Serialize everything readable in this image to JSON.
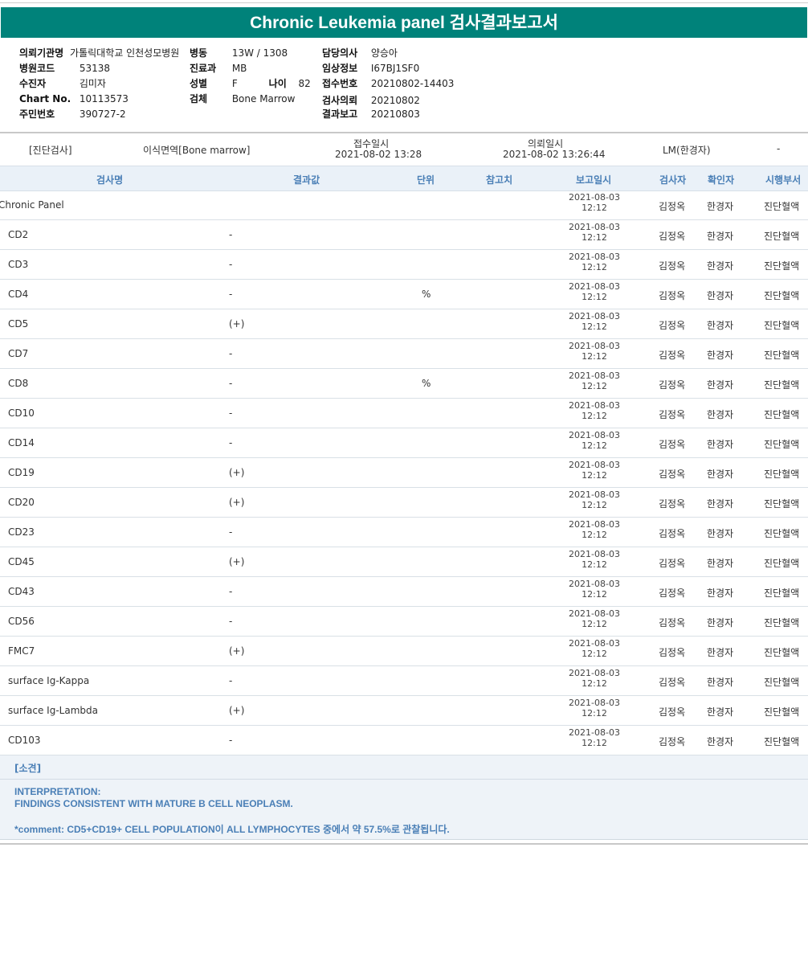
{
  "report": {
    "title": "Chronic Leukemia panel 검사결과보고서"
  },
  "patient": {
    "hospital_label": "의뢰기관명",
    "hospital_value": "가톨릭대학교 인천성모병원",
    "code_label": "병원코드",
    "code_value": "53138",
    "patient_label": "수진자",
    "patient_value": "김미자",
    "chart_label": "Chart No.",
    "chart_value": "10113573",
    "resident_label": "주민번호",
    "resident_value": "390727-2",
    "ward_label": "병동",
    "ward_value": "13W / 1308",
    "dept_label": "진료과",
    "dept_value": "MB",
    "sex_label": "성별",
    "sex_value": "F",
    "age_label": "나이",
    "age_value": "82",
    "specimen_label": "검체",
    "specimen_value": "Bone Marrow",
    "doctor_label": "담당의사",
    "doctor_value": "양승아",
    "clinical_label": "임상정보",
    "clinical_value": "I67BJ1SF0",
    "receipt_label": "접수번호",
    "receipt_value": "20210802-14403",
    "request_label": "검사의뢰",
    "request_value": "20210802",
    "result_label": "결과보고",
    "result_value": "20210803"
  },
  "summary": {
    "category": "[진단검사]",
    "test_type": "이식면역[Bone marrow]",
    "receipt_time_label": "접수일시",
    "receipt_time_value": "2021-08-02 13:28",
    "request_time_label": "의뢰일시",
    "request_time_value": "2021-08-02 13:26:44",
    "requester": "LM(한경자)",
    "dash": "-"
  },
  "table": {
    "headers": [
      "검사명",
      "결과값",
      "단위",
      "참고치",
      "보고일시",
      "검사자",
      "확인자",
      "시행부서"
    ],
    "rows": [
      {
        "name": "Chronic Panel",
        "result": "",
        "unit": "",
        "date": "2021-08-03",
        "time": "12:12",
        "checker": "김정옥",
        "confirmer": "한경자",
        "dept": "진단혈액"
      },
      {
        "name": "CD2",
        "result": "-",
        "unit": "",
        "date": "2021-08-03",
        "time": "12:12",
        "checker": "김정옥",
        "confirmer": "한경자",
        "dept": "진단혈액"
      },
      {
        "name": "CD3",
        "result": "-",
        "unit": "",
        "date": "2021-08-03",
        "time": "12:12",
        "checker": "김정옥",
        "confirmer": "한경자",
        "dept": "진단혈액"
      },
      {
        "name": "CD4",
        "result": "-",
        "unit": "%",
        "date": "2021-08-03",
        "time": "12:12",
        "checker": "김정옥",
        "confirmer": "한경자",
        "dept": "진단혈액"
      },
      {
        "name": "CD5",
        "result": "(+)",
        "unit": "",
        "date": "2021-08-03",
        "time": "12:12",
        "checker": "김정옥",
        "confirmer": "한경자",
        "dept": "진단혈액"
      },
      {
        "name": "CD7",
        "result": "-",
        "unit": "",
        "date": "2021-08-03",
        "time": "12:12",
        "checker": "김정옥",
        "confirmer": "한경자",
        "dept": "진단혈액"
      },
      {
        "name": "CD8",
        "result": "-",
        "unit": "%",
        "date": "2021-08-03",
        "time": "12:12",
        "checker": "김정옥",
        "confirmer": "한경자",
        "dept": "진단혈액"
      },
      {
        "name": "CD10",
        "result": "-",
        "unit": "",
        "date": "2021-08-03",
        "time": "12:12",
        "checker": "김정옥",
        "confirmer": "한경자",
        "dept": "진단혈액"
      },
      {
        "name": "CD14",
        "result": "-",
        "unit": "",
        "date": "2021-08-03",
        "time": "12:12",
        "checker": "김정옥",
        "confirmer": "한경자",
        "dept": "진단혈액"
      },
      {
        "name": "CD19",
        "result": "(+)",
        "unit": "",
        "date": "2021-08-03",
        "time": "12:12",
        "checker": "김정옥",
        "confirmer": "한경자",
        "dept": "진단혈액"
      },
      {
        "name": "CD20",
        "result": "(+)",
        "unit": "",
        "date": "2021-08-03",
        "time": "12:12",
        "checker": "김정옥",
        "confirmer": "한경자",
        "dept": "진단혈액"
      },
      {
        "name": "CD23",
        "result": "-",
        "unit": "",
        "date": "2021-08-03",
        "time": "12:12",
        "checker": "김정옥",
        "confirmer": "한경자",
        "dept": "진단혈액"
      },
      {
        "name": "CD45",
        "result": "(+)",
        "unit": "",
        "date": "2021-08-03",
        "time": "12:12",
        "checker": "김정옥",
        "confirmer": "한경자",
        "dept": "진단혈액"
      },
      {
        "name": "CD43",
        "result": "-",
        "unit": "",
        "date": "2021-08-03",
        "time": "12:12",
        "checker": "김정옥",
        "confirmer": "한경자",
        "dept": "진단혈액"
      },
      {
        "name": "CD56",
        "result": "-",
        "unit": "",
        "date": "2021-08-03",
        "time": "12:12",
        "checker": "김정옥",
        "confirmer": "한경자",
        "dept": "진단혈액"
      },
      {
        "name": "FMC7",
        "result": "(+)",
        "unit": "",
        "date": "2021-08-03",
        "time": "12:12",
        "checker": "김정옥",
        "confirmer": "한경자",
        "dept": "진단혈액"
      },
      {
        "name": "surface Ig-Kappa",
        "result": "-",
        "unit": "",
        "date": "2021-08-03",
        "time": "12:12",
        "checker": "김정옥",
        "confirmer": "한경자",
        "dept": "진단혈액"
      },
      {
        "name": "surface Ig-Lambda",
        "result": "(+)",
        "unit": "",
        "date": "2021-08-03",
        "time": "12:12",
        "checker": "김정옥",
        "confirmer": "한경자",
        "dept": "진단혈액"
      },
      {
        "name": "CD103",
        "result": "-",
        "unit": "",
        "date": "2021-08-03",
        "time": "12:12",
        "checker": "김정옥",
        "confirmer": "한경자",
        "dept": "진단혈액"
      }
    ]
  },
  "opinion": {
    "heading": "[소견]",
    "line1": "INTERPRETATION:",
    "line2": "FINDINGS CONSISTENT WITH MATURE B CELL NEOPLASM.",
    "line3": "*comment: CD5+CD19+ CELL POPULATION이 ALL LYMPHOCYTES 중에서 약 57.5%로 관찰됩니다."
  }
}
